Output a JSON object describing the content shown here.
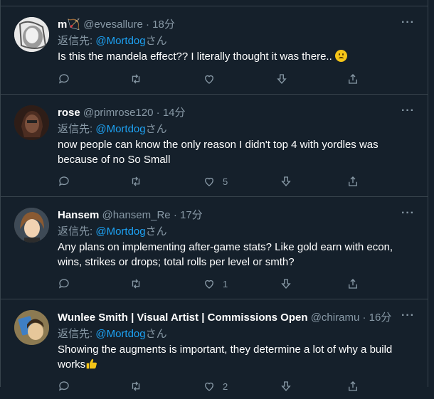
{
  "reply_prefix": "返信先:",
  "mention": "@Mortdog",
  "mention_suffix": "さん",
  "more_label": "···",
  "tweets": [
    {
      "name": "m🏹",
      "handle": "@evesallure",
      "dot": "·",
      "time": "18分",
      "text": "Is this the mandela effect?? I literally thought it was there..",
      "like_count": "",
      "avatar_color": "#cfcfcf"
    },
    {
      "name": "rose",
      "handle": "@primrose120",
      "dot": "·",
      "time": "14分",
      "text": "now people can know the only reason I didn't top 4 with yordles was because of no So Small",
      "like_count": "5",
      "avatar_color": "#4a2f24"
    },
    {
      "name": "Hansem",
      "handle": "@hansem_Re",
      "dot": "·",
      "time": "17分",
      "text": "Any plans on implementing after-game stats? Like gold earn with econ, wins, strikes or drops; total rolls per level or smth?",
      "like_count": "1",
      "avatar_color": "#c9a27a"
    },
    {
      "name": "Wunlee Smith | Visual Artist | Commissions Open",
      "handle": "@chiramu",
      "dot": "·",
      "time": "16分",
      "text": "Showing the augments is important, they determine a lot of why a build works",
      "like_count": "2",
      "avatar_color": "#6b5a3a"
    }
  ]
}
